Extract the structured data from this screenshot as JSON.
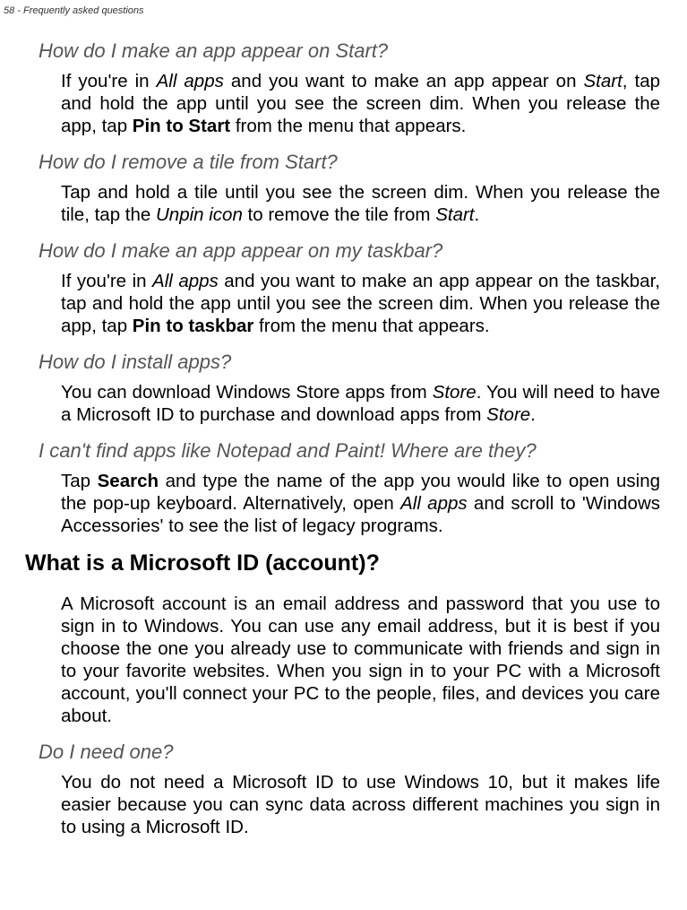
{
  "header": {
    "text": "58 - Frequently asked questions"
  },
  "sections": [
    {
      "question": "How do I make an app appear on Start?",
      "answer_html": "If you're in <span class='italic'>All apps</span> and you want to make an app appear on <span class='italic'>Start</span>, tap and hold the app until you see the screen dim. When you release the app, tap <span class='bold'>Pin to Start</span> from the menu that appears."
    },
    {
      "question": "How do I remove a tile from Start?",
      "answer_html": "Tap and hold a tile until you see the screen dim. When you release the tile, tap the <span class='italic'>Unpin icon</span> to remove the tile from <span class='italic'>Start</span>."
    },
    {
      "question": "How do I make an app appear on my taskbar?",
      "answer_html": "If you're in <span class='italic'>All apps</span> and you want to make an app appear on the taskbar, tap and hold the app until you see the screen dim. When you release the app, tap <span class='bold'>Pin to taskbar</span> from the menu that appears."
    },
    {
      "question": "How do I install apps?",
      "answer_html": "You can download Windows Store apps from <span class='italic'>Store</span>. You will need to have a Microsoft ID to purchase and download apps from <span class='italic'>Store</span>."
    },
    {
      "question": "I can't find apps like Notepad and Paint! Where are they?",
      "answer_html": "Tap <span class='bold'>Search</span> and type the name of the app you would like to open using the pop-up keyboard. Alternatively, open <span class='italic'>All apps</span> and scroll to 'Windows Accessories' to see the list of legacy programs."
    }
  ],
  "heading2": "What is a Microsoft ID (account)?",
  "microsoft_intro": "A Microsoft account is an email address and password that you use to sign in to Windows. You can use any email address, but it is best if you choose the one you already use to communicate with friends and sign in to your favorite websites. When you sign in to your PC with a Microsoft account, you'll connect your PC to the people, files, and devices you care about.",
  "sub2": {
    "question": "Do I need one?",
    "answer": "You do not need a Microsoft ID to use Windows 10, but it makes life easier because you can sync data across different machines you sign in to using a Microsoft ID."
  }
}
